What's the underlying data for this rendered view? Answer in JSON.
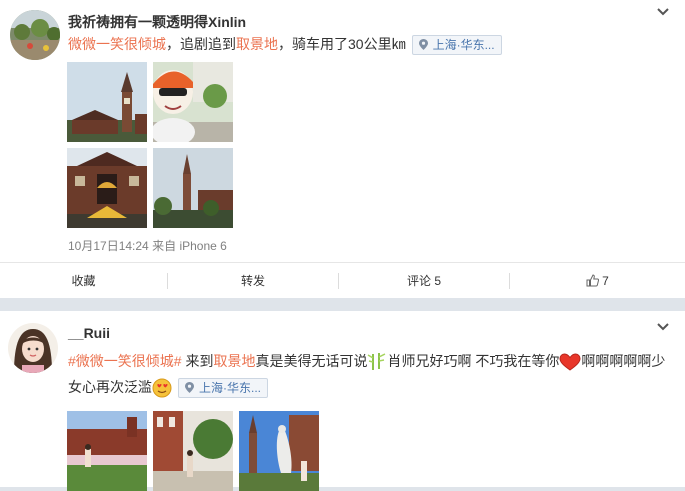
{
  "post1": {
    "author": "我祈祷拥有一颗透明得Xinlin",
    "text_topic": "微微一笑很倾城",
    "text_a": "，追剧追到",
    "text_link": "取景地",
    "text_b": "，骑车用了30公里㎞",
    "location": "上海·华东...",
    "time": "10月17日14:24",
    "source_prefix": "来自",
    "source": "iPhone 6",
    "actions": {
      "favorite": "收藏",
      "repost": "转发",
      "comment": "评论 5",
      "like_count": "7"
    }
  },
  "post2": {
    "author": "__Ruii",
    "topic": "#微微一笑很倾城#",
    "text_a": "来到",
    "text_link": "取景地",
    "text_b": "真是美得无话可说",
    "text_c": "肖师兄好巧啊 不巧我在等你",
    "text_d": "啊啊啊啊啊少",
    "text_line2": "女心再次泛滥",
    "location": "上海·华东..."
  },
  "colors": {
    "accent": "#eb7350",
    "link": "#4a76ad",
    "separator": "#dfe4ea"
  }
}
